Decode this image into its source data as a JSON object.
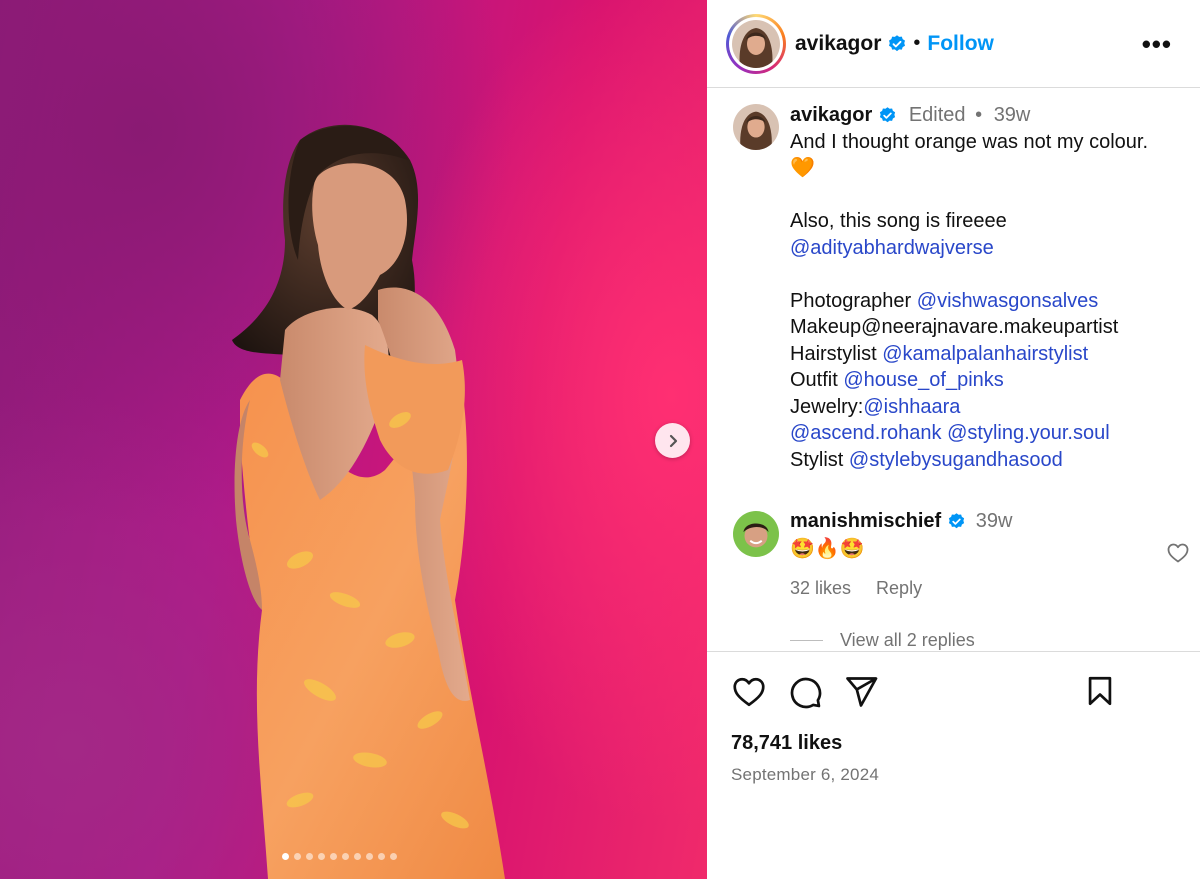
{
  "post": {
    "username": "avikagor",
    "follow_label": "Follow",
    "header_separator": "•",
    "more_label": "•••"
  },
  "caption": {
    "username": "avikagor",
    "edited_label": "Edited",
    "meta_separator": "•",
    "age": "39w",
    "line1": "And I thought orange was not my colour.",
    "emoji": "🧡",
    "line2": "Also, this song is fireeee",
    "mention1": "@adityabhardwajverse",
    "photographer_label": "Photographer",
    "photographer_mention": "@vishwasgonsalves",
    "makeup_text": "Makeup@neerajnavare.makeupartist",
    "hair_label": "Hairstylist",
    "hair_mention": "@kamalpalanhairstylist",
    "outfit_label": "Outfit",
    "outfit_mention": "@house_of_pinks",
    "jewelry_label": "Jewelry:",
    "jewelry_mention": "@ishhaara",
    "extra_mention1": "@ascend.rohank",
    "extra_mention2": "@styling.your.soul",
    "stylist_label": "Stylist",
    "stylist_mention": "@stylebysugandhasood"
  },
  "comment": {
    "username": "manishmischief",
    "age": "39w",
    "text": "🤩🔥🤩",
    "likes": "32 likes",
    "reply_label": "Reply",
    "view_replies": "View all 2 replies"
  },
  "footer": {
    "likes": "78,741 likes",
    "date": "September 6, 2024"
  },
  "carousel": {
    "slide_count": 10,
    "active_index": 0
  },
  "colors": {
    "link": "#0095f6",
    "mention": "#2947c9",
    "muted": "#737373",
    "verified": "#0095f6"
  },
  "icons": {
    "header_more": "more-horizontal-icon",
    "verified": "verified-badge-icon",
    "next": "chevron-right-icon",
    "like": "heart-icon",
    "comment": "comment-bubble-icon",
    "share": "paper-plane-icon",
    "save": "bookmark-icon"
  }
}
